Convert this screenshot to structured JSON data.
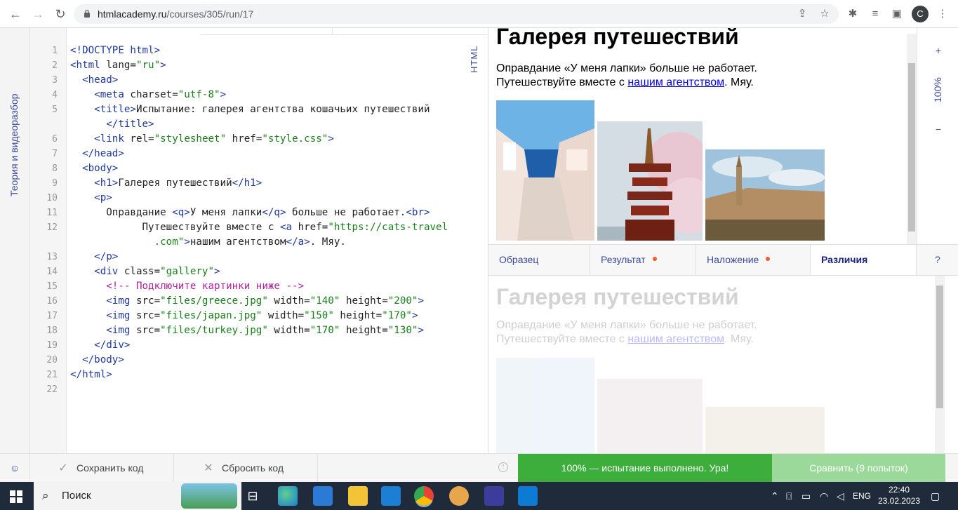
{
  "browser": {
    "url_host": "htmlacademy.ru",
    "url_path": "/courses/305/run/17",
    "profile_initial": "С"
  },
  "left_rail": {
    "label": "Теория и видеоразбор"
  },
  "editor": {
    "language_label": "HTML",
    "line_numbers": [
      "1",
      "2",
      "3",
      "4",
      "5",
      "",
      "6",
      "7",
      "8",
      "9",
      "10",
      "11",
      "12",
      "",
      "13",
      "14",
      "15",
      "16",
      "17",
      "18",
      "19",
      "20",
      "21",
      "22"
    ]
  },
  "preview": {
    "heading": "Галерея путешествий",
    "para_line1": "Оправдание «У меня лапки» больше не работает.",
    "para_line2_prefix": "Путешествуйте вместе с ",
    "para_link": "нашим агентством",
    "para_line2_suffix": ". Мяу."
  },
  "zoom": {
    "plus": "+",
    "percent": "100%",
    "minus": "−"
  },
  "mode_tabs": {
    "sample": "Образец",
    "result": "Результат",
    "overlay": "Наложение",
    "diff": "Различия",
    "help": "?"
  },
  "bottom_bar": {
    "save_label": "Сохранить код",
    "reset_label": "Сбросить код",
    "success_text": "100% — испытание выполнено. Ура!",
    "compare_label": "Сравнить (9 попыток)"
  },
  "taskbar": {
    "search_label": "Поиск",
    "lang": "ENG",
    "time": "22:40",
    "date": "23.02.2023"
  },
  "colors": {
    "accent": "#3b4a9a",
    "success": "#3dae3c",
    "compare": "#9ad99a",
    "dot": "#ff5a2a"
  }
}
